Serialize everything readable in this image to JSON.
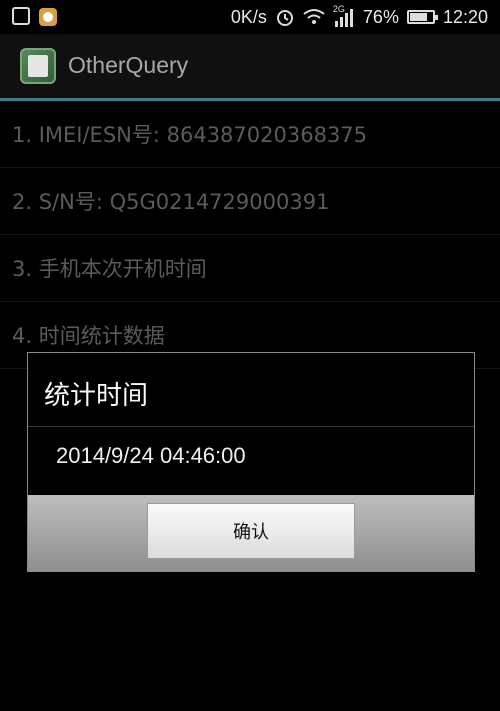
{
  "status_bar": {
    "speed": "0K/s",
    "network": "2G",
    "battery_percent": "76%",
    "battery_level": 0.76,
    "time": "12:20"
  },
  "app": {
    "title": "OtherQuery"
  },
  "list": {
    "items": [
      {
        "label": "1. IMEI/ESN号: 864387020368375"
      },
      {
        "label": "2. S/N号: Q5G0214729000391"
      },
      {
        "label": "3. 手机本次开机时间"
      },
      {
        "label": "4. 时间统计数据"
      }
    ]
  },
  "dialog": {
    "title": "统计时间",
    "message": "2014/9/24  04:46:00",
    "confirm_label": "确认"
  },
  "colors": {
    "accent": "#3b7f8a"
  }
}
